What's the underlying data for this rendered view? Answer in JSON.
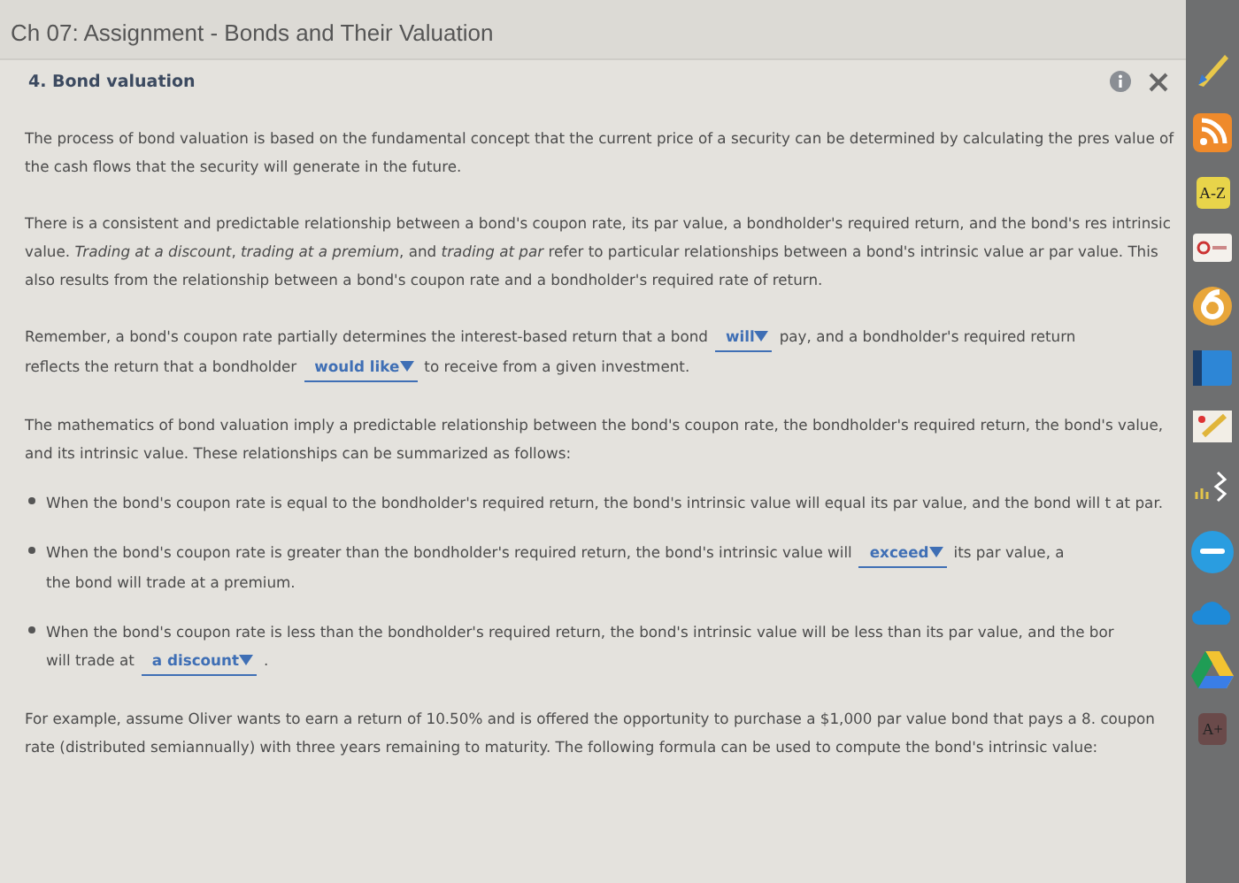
{
  "window": {
    "title": "Ch 07: Assignment - Bonds and Their Valuation"
  },
  "question": {
    "title": "4. Bond valuation"
  },
  "paragraphs": [
    {
      "kind": "text",
      "segments": [
        {
          "kind": "text",
          "text": "The process of bond valuation is based on the fundamental concept that the current price of a security can be determined by calculating the pres value of the cash flows that the security will generate in the future."
        }
      ]
    },
    {
      "kind": "text",
      "segments": [
        {
          "kind": "text",
          "text": "There is a consistent and predictable relationship between a bond's coupon rate, its par value, a bondholder's required return, and the bond's res intrinsic value. *Trading at a discount*, *trading at a premium*, and *trading at par* refer to particular relationships between a bond's intrinsic value ar par value. This also results from the relationship between a bond's coupon rate and a bondholder's required rate of return."
        }
      ]
    },
    {
      "kind": "text",
      "segments": [
        {
          "kind": "text",
          "text": "Remember, a bond's coupon rate partially determines the interest-based return that a bond"
        },
        {
          "kind": "dropdown",
          "text": "will"
        },
        {
          "kind": "text",
          "text": "pay, and a bondholder's required return"
        },
        {
          "kind": "text",
          "text": "reflects the return that a bondholder"
        },
        {
          "kind": "dropdown",
          "text": "would like"
        },
        {
          "kind": "text",
          "text": "to receive from a given investment."
        }
      ]
    },
    {
      "kind": "text",
      "segments": [
        {
          "kind": "text",
          "text": "The mathematics of bond valuation imply a predictable relationship between the bond's coupon rate, the bondholder's required return, the bond's value, and its intrinsic value. These relationships can be summarized as follows:"
        }
      ]
    },
    {
      "kind": "bullet",
      "segments": [
        {
          "kind": "text",
          "text": "When the bond's coupon rate is equal to the bondholder's required return, the bond's intrinsic value will equal its par value, and the bond will t at par."
        }
      ]
    },
    {
      "kind": "bullet",
      "segments": [
        {
          "kind": "text",
          "text": "When the bond's coupon rate is greater than the bondholder's required return, the bond's intrinsic value will"
        },
        {
          "kind": "dropdown",
          "text": "exceed"
        },
        {
          "kind": "text",
          "text": "its par value, a"
        },
        {
          "kind": "text",
          "text": "the bond will trade at a premium."
        }
      ]
    },
    {
      "kind": "bullet",
      "segments": [
        {
          "kind": "text",
          "text": "When the bond's coupon rate is less than the bondholder's required return, the bond's intrinsic value will be less than its par value, and the bor"
        },
        {
          "kind": "text",
          "text": "will trade at"
        },
        {
          "kind": "dropdown",
          "text": "a discount"
        },
        {
          "kind": "text",
          "text": "."
        }
      ]
    },
    {
      "kind": "text",
      "segments": [
        {
          "kind": "text",
          "text": "For example, assume Oliver wants to earn a return of 10.50% and is offered the opportunity to purchase a $1,000 par value bond that pays a 8. coupon rate (distributed semiannually) with three years remaining to maturity. The following formula can be used to compute the bond's intrinsic value:"
        }
      ]
    }
  ],
  "dock": [
    {
      "kind": "pen"
    },
    {
      "kind": "rss"
    },
    {
      "kind": "label",
      "label": "A-Z",
      "color": "#e8d44a"
    },
    {
      "kind": "card"
    },
    {
      "kind": "ring"
    },
    {
      "kind": "book"
    },
    {
      "kind": "note"
    },
    {
      "kind": "wave"
    },
    {
      "kind": "bubble"
    },
    {
      "kind": "cloud"
    },
    {
      "kind": "triangle"
    },
    {
      "kind": "label",
      "label": "A+",
      "color": "#6a4a4a"
    }
  ]
}
